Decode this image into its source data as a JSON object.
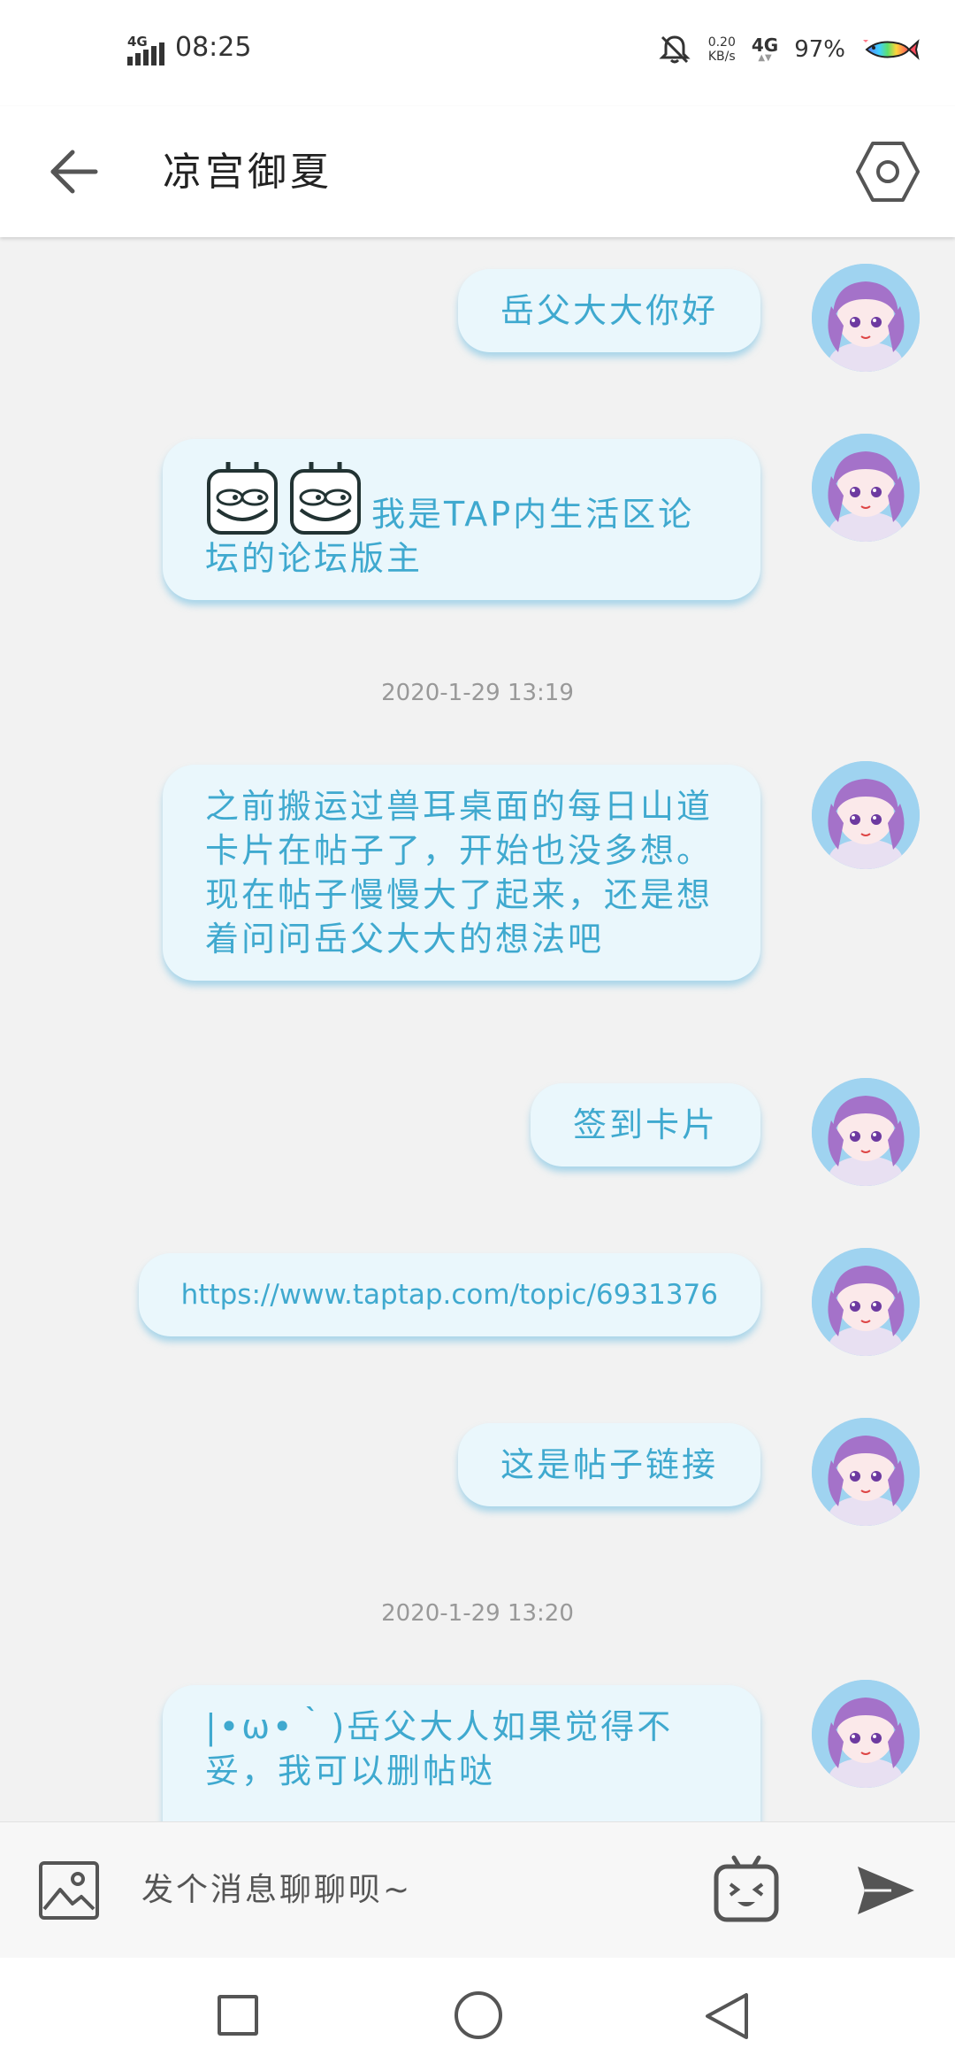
{
  "status_bar": {
    "network_label": "4G",
    "time": "08:25",
    "speed_value": "0.20",
    "speed_unit": "KB/s",
    "network_type": "4G",
    "battery": "97%"
  },
  "header": {
    "title": "凉宫御夏"
  },
  "messages": [
    {
      "type": "text",
      "text": "岳父大大你好"
    },
    {
      "type": "text_with_emoji",
      "emoji_count": 2,
      "text": "我是TAP内生活区论坛的论坛版主"
    },
    {
      "type": "timestamp",
      "text": "2020-1-29 13:19"
    },
    {
      "type": "text",
      "text": "之前搬运过兽耳桌面的每日山道卡片在帖子了，开始也没多想。现在帖子慢慢大了起来，还是想着问问岳父大大的想法吧"
    },
    {
      "type": "text",
      "text": "签到卡片"
    },
    {
      "type": "text",
      "text": "https://www.taptap.com/topic/6931376"
    },
    {
      "type": "text",
      "text": "这是帖子链接"
    },
    {
      "type": "timestamp",
      "text": "2020-1-29 13:20"
    },
    {
      "type": "text",
      "text": "|•ω•｀)岳父大人如果觉得不妥，我可以删帖哒"
    }
  ],
  "input": {
    "placeholder": "发个消息聊聊呗~"
  },
  "icons": {
    "back": "arrow-left-icon",
    "settings": "hexagon-settings-icon",
    "image": "image-icon",
    "emoji": "tv-emoji-icon",
    "send": "send-icon"
  },
  "colors": {
    "bubble_bg": "#eaf7fc",
    "bubble_text": "#3fa9cf",
    "chat_bg": "#f2f2f2"
  }
}
